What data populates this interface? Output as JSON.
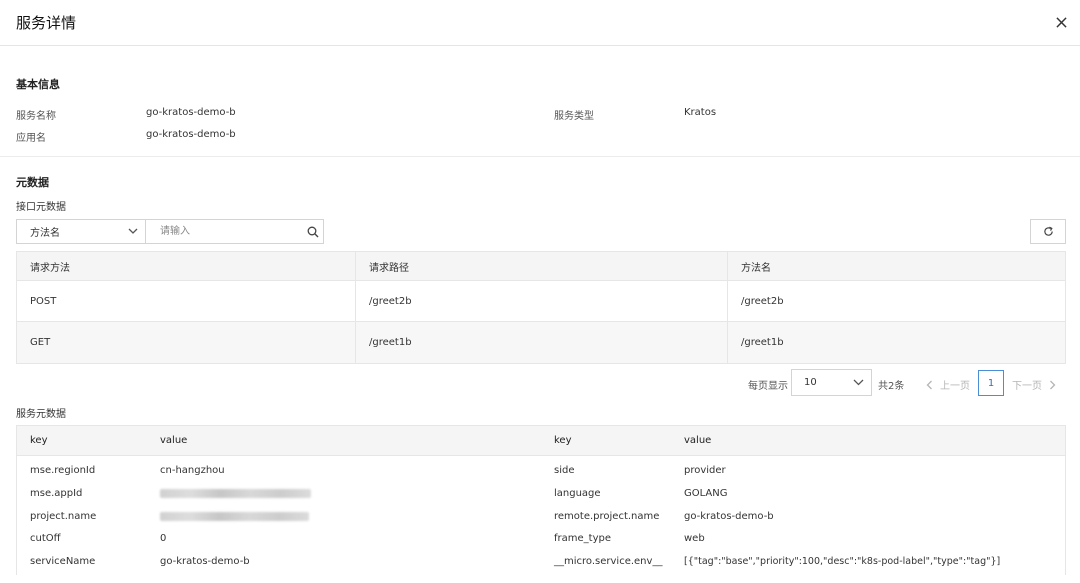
{
  "header": {
    "title": "服务详情",
    "close_icon": "close-icon"
  },
  "basic": {
    "title": "基本信息",
    "service_name_label": "服务名称",
    "service_name_value": "go-kratos-demo-b",
    "service_type_label": "服务类型",
    "service_type_value": "Kratos",
    "app_name_label": "应用名",
    "app_name_value": "go-kratos-demo-b"
  },
  "metadata": {
    "title": "元数据",
    "interface_title": "接口元数据",
    "filter_select_value": "方法名",
    "search_placeholder": "请输入",
    "refresh_icon": "refresh-icon",
    "columns": [
      "请求方法",
      "请求路径",
      "方法名"
    ],
    "rows": [
      [
        "POST",
        "/greet2b",
        "/greet2b"
      ],
      [
        "GET",
        "/greet1b",
        "/greet1b"
      ]
    ]
  },
  "pagination": {
    "page_size_label": "每页显示",
    "page_size_value": "10",
    "total": "共2条",
    "prev": "上一页",
    "current": "1",
    "next": "下一页"
  },
  "service_meta": {
    "title": "服务元数据",
    "headers": {
      "key1": "key",
      "value1": "value",
      "key2": "key",
      "value2": "value"
    },
    "left": [
      {
        "key": "mse.regionId",
        "value": "cn-hangzhou"
      },
      {
        "key": "mse.appId",
        "value": ""
      },
      {
        "key": "project.name",
        "value": ""
      },
      {
        "key": "cutOff",
        "value": "0"
      },
      {
        "key": "serviceName",
        "value": "go-kratos-demo-b"
      }
    ],
    "right": [
      {
        "key": "side",
        "value": "provider"
      },
      {
        "key": "language",
        "value": "GOLANG"
      },
      {
        "key": "remote.project.name",
        "value": "go-kratos-demo-b"
      },
      {
        "key": "frame_type",
        "value": "web"
      },
      {
        "key": "__micro.service.env__",
        "value": "[{\"tag\":\"base\",\"priority\":100,\"desc\":\"k8s-pod-label\",\"type\":\"tag\"}]"
      }
    ]
  }
}
